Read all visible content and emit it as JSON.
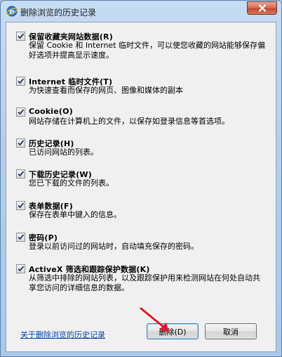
{
  "window": {
    "title": "删除浏览的历史记录",
    "close_glyph": "✕"
  },
  "options": [
    {
      "title": "保留收藏夹网站数据(R)",
      "desc": "保留 Cookie 和 Internet 临时文件，可以使您收藏的网站能够保存偏好选项并提高显示速度。",
      "checked": true
    },
    {
      "title": "Internet 临时文件(T)",
      "desc": "为快速查看而保存的网页、图像和媒体的副本",
      "checked": true
    },
    {
      "title": "Cookie(O)",
      "desc": "网站存储在计算机上的文件，以保存如登录信息等首选项。",
      "checked": true
    },
    {
      "title": "历史记录(H)",
      "desc": "已访问网站的列表。",
      "checked": true
    },
    {
      "title": "下载历史记录(W)",
      "desc": "您已下载的文件的列表。",
      "checked": true
    },
    {
      "title": "表单数据(F)",
      "desc": "保存在表单中键入的信息。",
      "checked": true
    },
    {
      "title": "密码(P)",
      "desc": "登录以前访问过的网站时，自动填充保存的密码。",
      "checked": true
    },
    {
      "title": "ActiveX 筛选和跟踪保护数据(K)",
      "desc": "从筛选中排除的网站列表，以及跟踪保护用来检测网站在何处自动共享您访问的详细信息的数据。",
      "checked": true
    }
  ],
  "footer": {
    "link": "关于删除浏览的历史记录",
    "delete_button": "删除(D)",
    "cancel_button": "取消"
  },
  "colors": {
    "link": "#0645ad",
    "annotation_arrow": "#e0182a"
  },
  "icons": {
    "app": "internet-explorer-icon",
    "close": "close-icon",
    "check": "checkmark-icon",
    "annotation": "red-arrow-icon"
  }
}
